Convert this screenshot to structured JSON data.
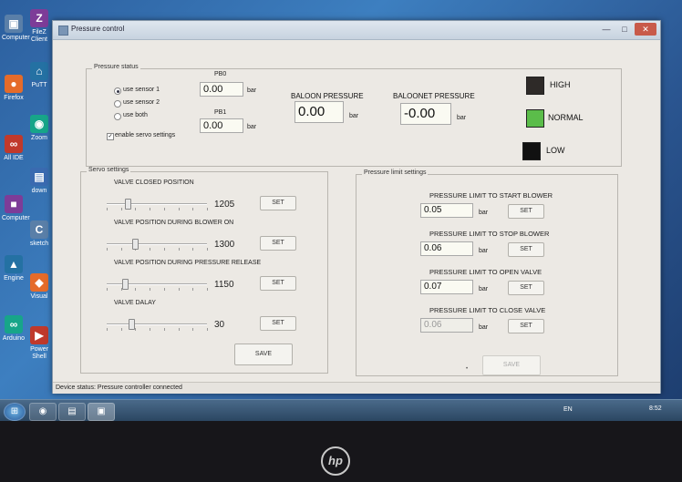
{
  "window": {
    "title": "Pressure control"
  },
  "desktop_icons": [
    {
      "label": "Computer",
      "glyph": "▣"
    },
    {
      "label": "Firefox",
      "glyph": "●"
    },
    {
      "label": "All IDE",
      "glyph": "∞"
    },
    {
      "label": "Computer",
      "glyph": "■"
    },
    {
      "label": "Engine",
      "glyph": "▲"
    },
    {
      "label": "Arduino",
      "glyph": "∞"
    }
  ],
  "desktop_icons_col2": [
    {
      "label": "FileZ Client",
      "glyph": "Z"
    },
    {
      "label": "PuTT",
      "glyph": "⌂"
    },
    {
      "label": "Zoom",
      "glyph": "◉"
    },
    {
      "label": "down",
      "glyph": "▤"
    },
    {
      "label": "sketch",
      "glyph": "C"
    },
    {
      "label": "Visual",
      "glyph": "◆"
    },
    {
      "label": "Power Shell",
      "glyph": "▶"
    }
  ],
  "pressure_status": {
    "group_label": "Pressure status",
    "radios": [
      "use sensor 1",
      "use sensor 2",
      "use both"
    ],
    "checkbox": "enable servo settings",
    "pb0_label": "PB0",
    "pb0_value": "0.00",
    "pb0_unit": "bar",
    "pb1_label": "PB1",
    "pb1_value": "0.00",
    "pb1_unit": "bar",
    "baloon_label": "BALOON PRESSURE",
    "baloon_value": "0.00",
    "baloon_unit": "bar",
    "baloonet_label": "BALOONET PRESSURE",
    "baloonet_value": "-0.00",
    "baloonet_unit": "bar",
    "indicators": [
      {
        "label": "HIGH",
        "color": "#2e2a28"
      },
      {
        "label": "NORMAL",
        "color": "#5bbd4a"
      },
      {
        "label": "LOW",
        "color": "#111111"
      }
    ]
  },
  "servo": {
    "group_label": "Servo settings",
    "rows": [
      {
        "label": "VALVE CLOSED POSITION",
        "value": "1205",
        "button": "SET",
        "level": 0.18
      },
      {
        "label": "VALVE POSITION DURING BLOWER ON",
        "value": "1300",
        "button": "SET",
        "level": 0.25
      },
      {
        "label": "VALVE POSITION DURING  PRESSURE RELEASE",
        "value": "1150",
        "button": "SET",
        "level": 0.15
      },
      {
        "label": "VALVE DALAY",
        "value": "30",
        "button": "SET",
        "level": 0.22
      }
    ],
    "save_label": "SAVE"
  },
  "limits": {
    "group_label": "Pressure limit settings",
    "rows": [
      {
        "label": "PRESSURE LIMIT TO START BLOWER",
        "value": "0.05",
        "unit": "bar",
        "button": "SET"
      },
      {
        "label": "PRESSURE LIMIT TO STOP BLOWER",
        "value": "0.06",
        "unit": "bar",
        "button": "SET"
      },
      {
        "label": "PRESSURE LIMIT TO OPEN VALVE",
        "value": "0.07",
        "unit": "bar",
        "button": "SET"
      },
      {
        "label": "PRESSURE LIMIT TO CLOSE VALVE",
        "value": "0.06",
        "unit": "bar",
        "button": "SET"
      }
    ],
    "save_label": "SAVE"
  },
  "status_bar": {
    "text": "Device status: Pressure controller connected"
  },
  "taskbar": {
    "lang": "EN",
    "clock": "8:52"
  },
  "brand": {
    "logo": "hp"
  }
}
